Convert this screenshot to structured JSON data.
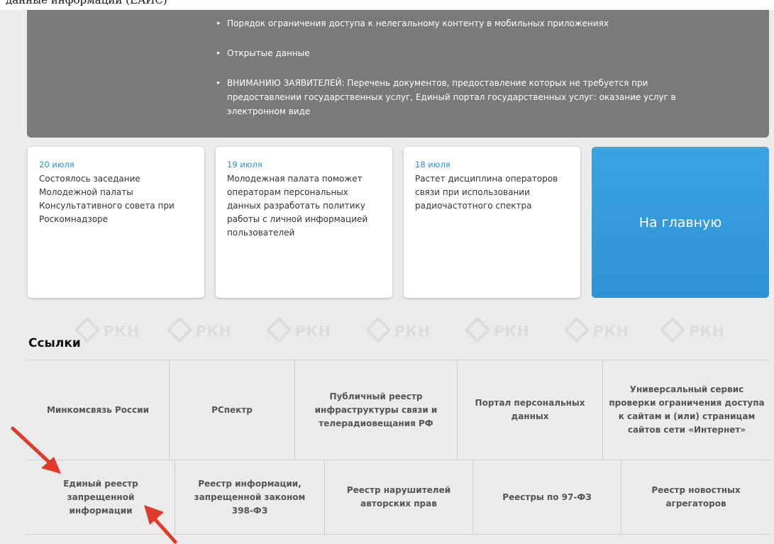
{
  "top_clip_text": "данные информации (ЕАИС)",
  "watermark": "РКН",
  "gray_menu": [
    {
      "bullet": "▸",
      "text": "Порядок ограничения доступа к нелегальному контенту в мобильных приложениях"
    },
    {
      "bullet": "▸",
      "text": "Открытые данные"
    },
    {
      "bullet": "▸",
      "text": "ВНИМАНИЮ ЗАЯВИТЕЛЕЙ: Перечень документов, предоставление которых не требуется при предоставлении государственных услуг, Единый портал государственных услуг: оказание услуг в электронном виде"
    }
  ],
  "news": [
    {
      "date": "20 июля",
      "text": "Состоялось заседание Молодежной палаты Консультативного совета при Роскомнадзоре"
    },
    {
      "date": "19 июля",
      "text": "Молодежная палата поможет операторам персональных данных разработать политику работы с личной информацией пользователей"
    },
    {
      "date": "18 июля",
      "text": "Растет дисциплина операторов связи при использовании радиочастотного спектра"
    }
  ],
  "home_button": "На главную",
  "links_heading": "Ссылки",
  "links_row1": [
    "Минкомсвязь России",
    "РСпектр",
    "Публичный реестр инфраструктуры связи и телерадиовещания РФ",
    "Портал персональных данных",
    "Универсальный сервис проверки ограничения доступа к сайтам и (или) страницам сайтов сети «Интернет»"
  ],
  "links_row2": [
    "Единый реестр запрещенной информации",
    "Реестр информации, запрещенной законом 398-ФЗ",
    "Реестр нарушителей авторских прав",
    "Реестры по 97-ФЗ",
    "Реестр новостных агрегаторов"
  ],
  "colors": {
    "accent": "#2f92d6",
    "arrow": "#e03a2a",
    "menu_bg": "#7a7a7a"
  }
}
